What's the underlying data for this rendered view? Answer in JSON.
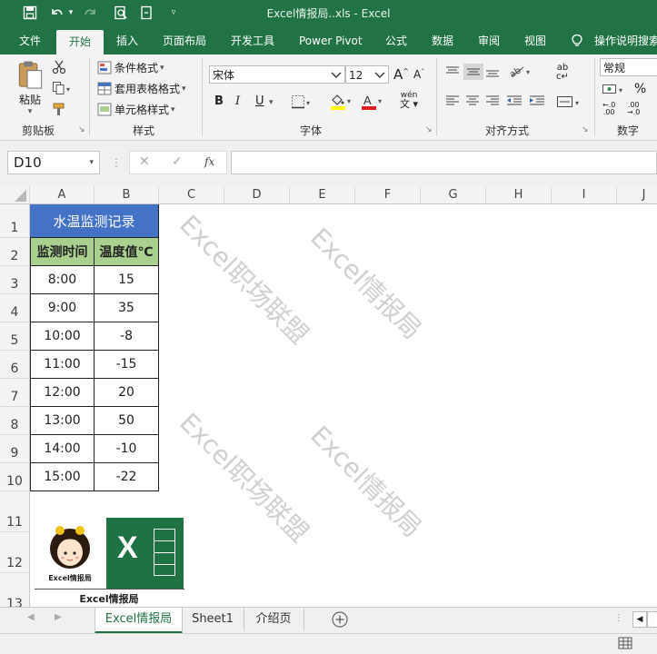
{
  "window": {
    "title": "Excel情报局..xls  -  Excel"
  },
  "ribbon_tabs": [
    "文件",
    "开始",
    "插入",
    "页面布局",
    "开发工具",
    "Power Pivot",
    "公式",
    "数据",
    "审阅",
    "视图",
    "操作说明搜索"
  ],
  "clipboard": {
    "paste": "粘贴",
    "label": "剪贴板"
  },
  "styles": {
    "conditional": "条件格式",
    "table": "套用表格格式",
    "cell": "单元格样式",
    "label": "样式"
  },
  "font": {
    "name": "宋体",
    "size": "12",
    "bold": "B",
    "italic": "I",
    "underline": "U",
    "grow": "A",
    "shrink": "A",
    "phonetic": "wén",
    "label": "字体"
  },
  "alignment": {
    "label": "对齐方式"
  },
  "number": {
    "format": "常规",
    "percent": "%",
    "label": "数字"
  },
  "formula_bar": {
    "name_box": "D10",
    "cancel": "✕",
    "enter": "✓",
    "fx": "fx",
    "value": ""
  },
  "columns": [
    "A",
    "B",
    "C",
    "D",
    "E",
    "F",
    "G",
    "H",
    "I",
    "J"
  ],
  "rows": [
    "1",
    "2",
    "3",
    "4",
    "5",
    "6",
    "7",
    "8",
    "9",
    "10",
    "11",
    "12",
    "13"
  ],
  "table": {
    "title": "水温监测记录",
    "headers": [
      "监测时间",
      "温度值℃"
    ],
    "data": [
      [
        "8:00",
        "15"
      ],
      [
        "9:00",
        "35"
      ],
      [
        "10:00",
        "-8"
      ],
      [
        "11:00",
        "-15"
      ],
      [
        "12:00",
        "20"
      ],
      [
        "13:00",
        "50"
      ],
      [
        "14:00",
        "-10"
      ],
      [
        "15:00",
        "-22"
      ]
    ],
    "title_bg": "#4472c4",
    "header_bg": "#a9d08e"
  },
  "watermarks": [
    "Excel职场联盟",
    "Excel情报局",
    "Excel职场联盟",
    "Excel情报局"
  ],
  "logos": {
    "avatar_caption": "Excel情报局",
    "bottom_caption": "Excel情报局",
    "excel_letter": "X"
  },
  "sheet_tabs": [
    "Excel情报局",
    "Sheet1",
    "介绍页"
  ],
  "active_sheet": "Excel情报局",
  "colors": {
    "accent": "#217346",
    "ribbon": "#f3f3f3"
  }
}
